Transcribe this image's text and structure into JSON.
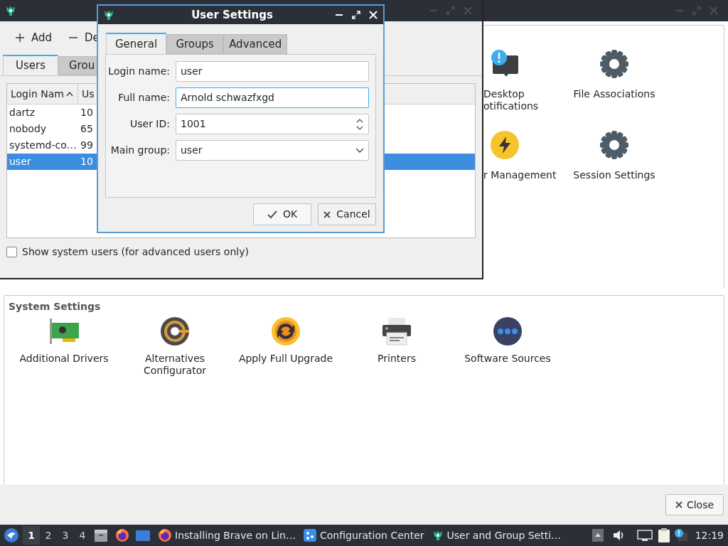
{
  "config_window": {
    "top_items": [
      {
        "lines": [
          "Desktop",
          "otifications"
        ],
        "kind": "notify"
      },
      {
        "lines": [
          "File Associations"
        ],
        "kind": "gear"
      },
      {
        "lines": [
          "r Management"
        ],
        "kind": "power"
      },
      {
        "lines": [
          "Session Settings"
        ],
        "kind": "gear"
      }
    ],
    "system_settings": {
      "title": "System Settings",
      "items": [
        {
          "lines": [
            "Additional Drivers"
          ],
          "kind": "card"
        },
        {
          "lines": [
            "Alternatives",
            "Configurator"
          ],
          "kind": "alternatives"
        },
        {
          "lines": [
            "Apply Full Upgrade"
          ],
          "kind": "upgrade"
        },
        {
          "lines": [
            "Printers"
          ],
          "kind": "printer"
        },
        {
          "lines": [
            "Software Sources"
          ],
          "kind": "sources"
        }
      ]
    },
    "close_button": "Close"
  },
  "users_window": {
    "toolbar": [
      {
        "label": "Add",
        "kind": "add"
      },
      {
        "label": "De",
        "kind": "remove"
      }
    ],
    "tabs": [
      {
        "label": "Users",
        "selected": true
      },
      {
        "label": "Grou",
        "selected": false
      }
    ],
    "table": {
      "columns": [
        {
          "label": "Login Nam",
          "kind": "sorted"
        },
        {
          "label": "Us",
          "kind": "plain"
        }
      ],
      "rows": [
        {
          "cells": [
            "dartz",
            "10"
          ],
          "selected": false
        },
        {
          "cells": [
            "nobody",
            "65"
          ],
          "selected": false
        },
        {
          "cells": [
            "systemd-co…",
            "99"
          ],
          "selected": false
        },
        {
          "cells": [
            "user",
            "10"
          ],
          "selected": true
        }
      ]
    },
    "show_system_users": {
      "label": "Show system users (for advanced users only)",
      "checked": false
    }
  },
  "dialog": {
    "title": "User Settings",
    "tabs": [
      {
        "label": "General",
        "selected": true
      },
      {
        "label": "Groups",
        "selected": false
      },
      {
        "label": "Advanced",
        "selected": false
      }
    ],
    "fields": [
      {
        "label": "Login name:",
        "value": "user",
        "kind": "text",
        "focused": false
      },
      {
        "label": "Full name:",
        "value": "Arnold schwazfxgd",
        "kind": "text",
        "focused": true
      },
      {
        "label": "User ID:",
        "value": "1001",
        "kind": "spin",
        "focused": false
      },
      {
        "label": "Main group:",
        "value": "user",
        "kind": "select",
        "focused": false
      }
    ],
    "buttons": [
      {
        "label": "OK",
        "kind": "ok"
      },
      {
        "label": "Cancel",
        "kind": "cancel"
      }
    ]
  },
  "taskbar": {
    "workspaces": [
      {
        "label": "1",
        "selected": true
      },
      {
        "label": "2",
        "selected": false
      },
      {
        "label": "3",
        "selected": false
      },
      {
        "label": "4",
        "selected": false
      }
    ],
    "tasks": [
      {
        "label": "Installing Brave on Lin…",
        "kind": "firefox"
      },
      {
        "label": "Configuration Center",
        "kind": "config"
      },
      {
        "label": "User and Group Setti…",
        "kind": "users"
      }
    ],
    "clock": "12:19"
  }
}
